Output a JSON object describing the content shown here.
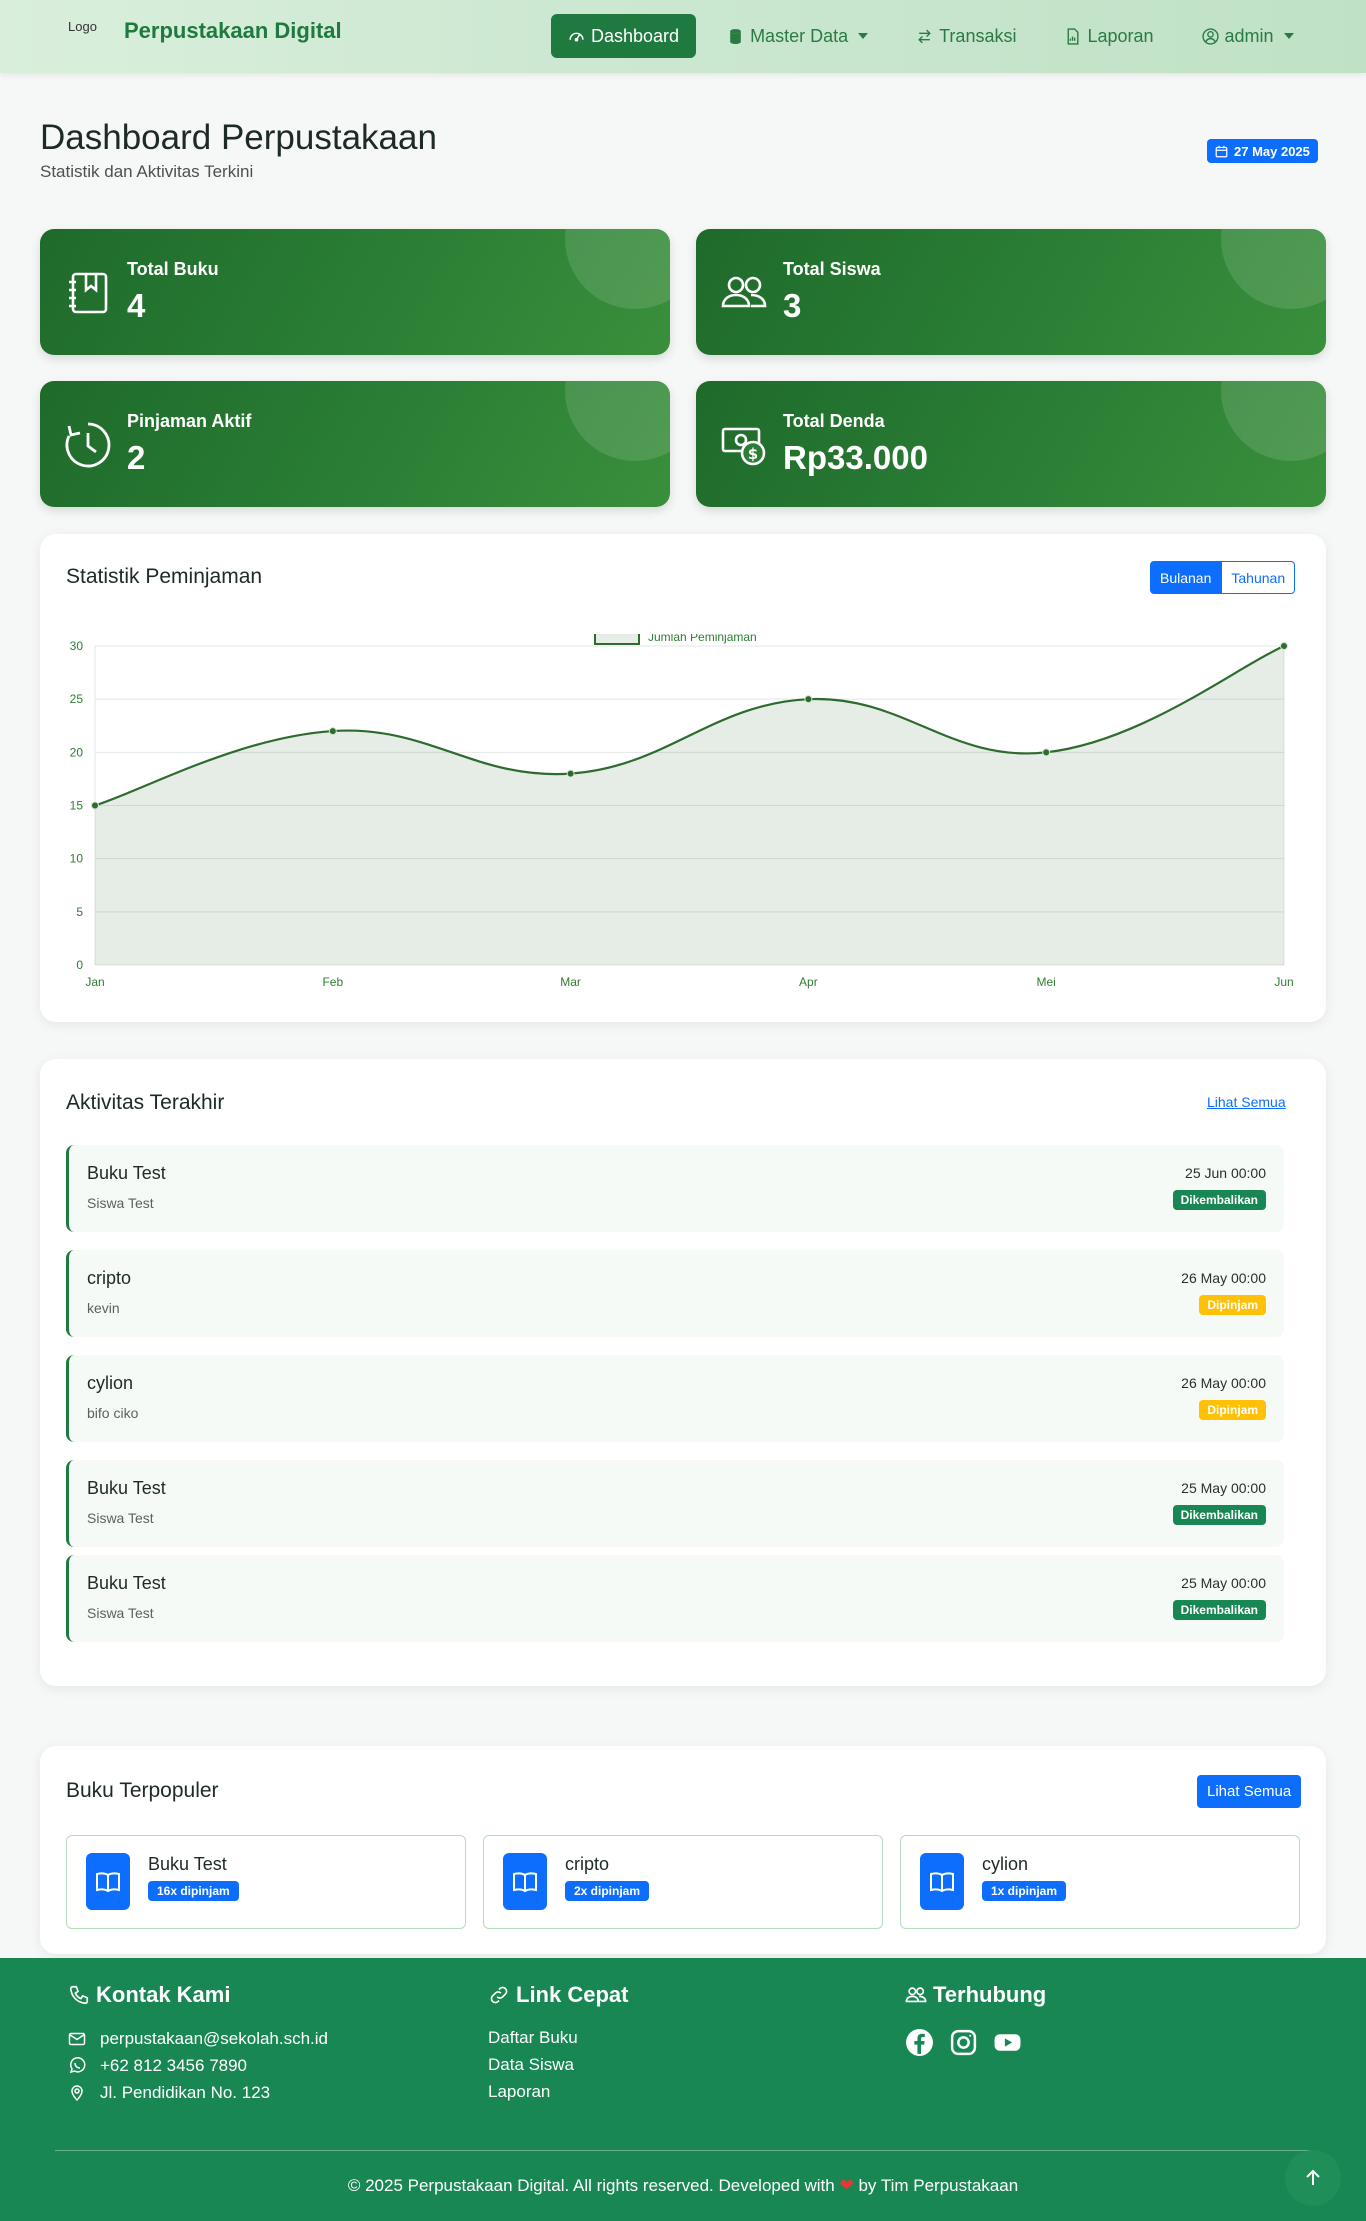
{
  "nav": {
    "logo_alt": "Logo",
    "brand": "Perpustakaan Digital",
    "items": [
      {
        "label": "Dashboard",
        "icon": "speedometer-icon",
        "active": true
      },
      {
        "label": "Master Data",
        "icon": "database-icon",
        "dropdown": true
      },
      {
        "label": "Transaksi",
        "icon": "arrow-left-right-icon"
      },
      {
        "label": "Laporan",
        "icon": "file-chart-icon"
      },
      {
        "label": "admin",
        "icon": "user-circle-icon",
        "dropdown": true
      }
    ]
  },
  "header": {
    "title": "Dashboard Perpustakaan",
    "subtitle": "Statistik dan Aktivitas Terkini",
    "date": "27 May 2025"
  },
  "stats": [
    {
      "label": "Total Buku",
      "value": "4",
      "icon": "journal-bookmark-icon"
    },
    {
      "label": "Total Siswa",
      "value": "3",
      "icon": "people-icon"
    },
    {
      "label": "Pinjaman Aktif",
      "value": "2",
      "icon": "clock-icon"
    },
    {
      "label": "Total Denda",
      "value": "Rp33.000",
      "icon": "cash-coin-icon"
    }
  ],
  "chart_panel": {
    "title": "Statistik Peminjaman",
    "toggle": {
      "monthly": "Bulanan",
      "yearly": "Tahunan",
      "selected": "Bulanan"
    }
  },
  "chart_data": {
    "type": "area",
    "categories": [
      "Jan",
      "Feb",
      "Mar",
      "Apr",
      "Mei",
      "Jun"
    ],
    "series": [
      {
        "name": "Jumlah Peminjaman",
        "values": [
          15,
          22,
          18,
          25,
          20,
          30
        ]
      }
    ],
    "ylim": [
      0,
      30
    ],
    "yticks": [
      "0",
      "5",
      "10",
      "15",
      "20",
      "25",
      "30"
    ],
    "grid": true,
    "legend": "top",
    "color": "#2e6b2e"
  },
  "activity": {
    "title": "Aktivitas Terakhir",
    "see_all": "Lihat Semua",
    "items": [
      {
        "book": "Buku Test",
        "student": "Siswa Test",
        "time": "25 Jun 00:00",
        "status": "Dikembalikan"
      },
      {
        "book": "cripto",
        "student": "kevin",
        "time": "26 May 00:00",
        "status": "Dipinjam"
      },
      {
        "book": "cylion",
        "student": "bifo ciko",
        "time": "26 May 00:00",
        "status": "Dipinjam"
      },
      {
        "book": "Buku Test",
        "student": "Siswa Test",
        "time": "25 May 00:00",
        "status": "Dikembalikan"
      },
      {
        "book": "Buku Test",
        "student": "Siswa Test",
        "time": "25 May 00:00",
        "status": "Dikembalikan"
      }
    ]
  },
  "popular": {
    "title": "Buku Terpopuler",
    "see_all": "Lihat Semua",
    "books": [
      {
        "title": "Buku Test",
        "count": "16x dipinjam"
      },
      {
        "title": "cripto",
        "count": "2x dipinjam"
      },
      {
        "title": "cylion",
        "count": "1x dipinjam"
      }
    ]
  },
  "footer": {
    "contact_heading": "Kontak Kami",
    "email": "perpustakaan@sekolah.sch.id",
    "phone": "+62 812 3456 7890",
    "address": "Jl. Pendidikan No. 123",
    "links_heading": "Link Cepat",
    "links": [
      "Daftar Buku",
      "Data Siswa",
      "Laporan"
    ],
    "social_heading": "Terhubung",
    "social": [
      "facebook-icon",
      "instagram-icon",
      "youtube-icon"
    ],
    "copy_before": "© 2025 Perpustakaan Digital. All rights reserved. Developed with",
    "copy_after": "by Tim Perpustakaan"
  }
}
